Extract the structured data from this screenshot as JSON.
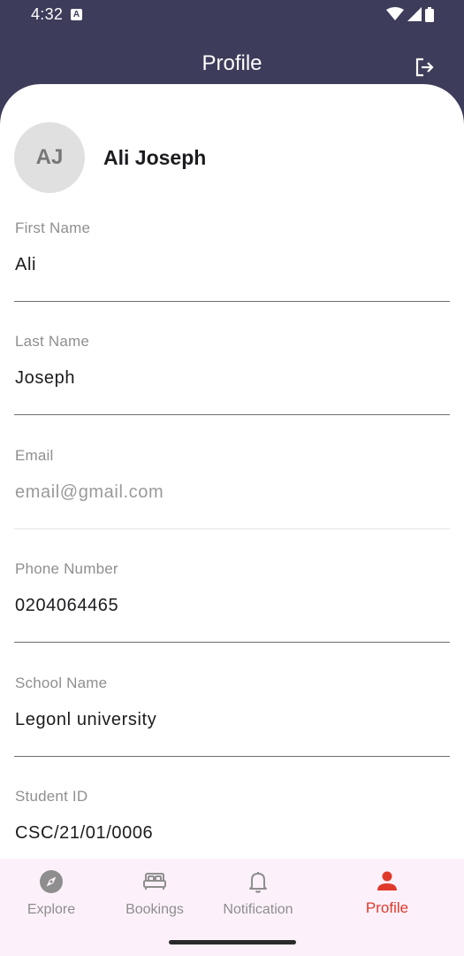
{
  "status_bar": {
    "time": "4:32",
    "icons": [
      "text-a-icon",
      "wifi-icon",
      "signal-icon",
      "battery-icon"
    ]
  },
  "app_bar": {
    "title": "Profile",
    "action_icon": "logout-icon"
  },
  "profile": {
    "initials": "AJ",
    "name": "Ali Joseph"
  },
  "form": {
    "first_name": {
      "label": "First Name",
      "value": "Ali"
    },
    "last_name": {
      "label": "Last Name",
      "value": "Joseph"
    },
    "email": {
      "label": "Email",
      "value": "",
      "placeholder": "email@gmail.com"
    },
    "phone": {
      "label": "Phone Number",
      "value": "0204064465"
    },
    "school": {
      "label": "School Name",
      "value": "Legonl university"
    },
    "student_id": {
      "label": "Student ID",
      "value": "CSC/21/01/0006"
    }
  },
  "bottom_nav": {
    "items": [
      {
        "label": "Explore",
        "icon": "compass-icon",
        "active": false
      },
      {
        "label": "Bookings",
        "icon": "bed-icon",
        "active": false
      },
      {
        "label": "Notification",
        "icon": "bell-icon",
        "active": false
      },
      {
        "label": "Profile",
        "icon": "person-icon",
        "active": true
      }
    ]
  },
  "colors": {
    "header_bg": "#3d3c5a",
    "active_nav": "#e0392c",
    "nav_bg": "#fcf1fa"
  }
}
